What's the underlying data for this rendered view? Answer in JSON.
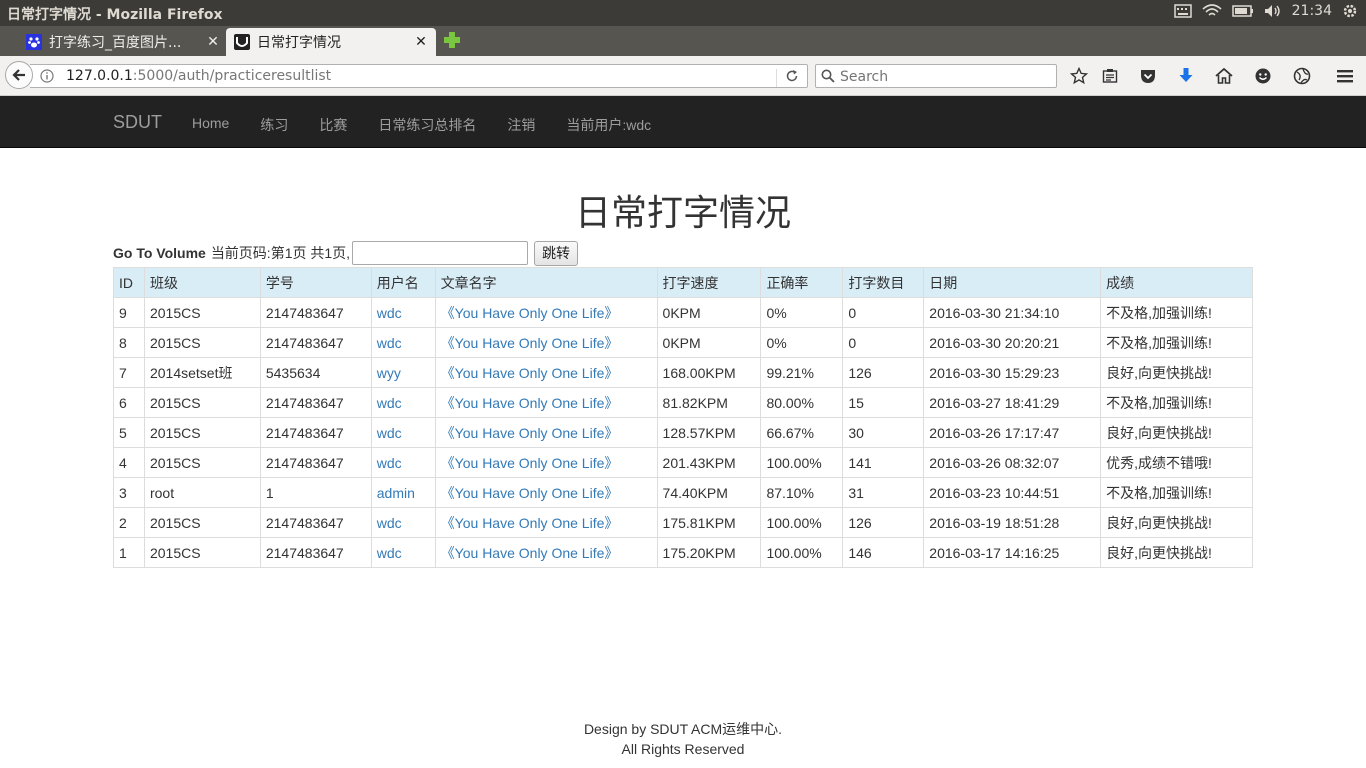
{
  "os": {
    "window_title": "日常打字情况 - Mozilla Firefox",
    "clock": "21:34"
  },
  "browser": {
    "tabs": [
      {
        "label": "打字练习_百度图片...",
        "active": false
      },
      {
        "label": "日常打字情况",
        "active": true
      }
    ],
    "url_host": "127.0.0.1",
    "url_path": ":5000/auth/practiceresultlist",
    "search_placeholder": "Search"
  },
  "site_nav": {
    "brand": "SDUT",
    "links": [
      "Home",
      "练习",
      "比赛",
      "日常练习总排名",
      "注销",
      "当前用户:wdc"
    ]
  },
  "page": {
    "title": "日常打字情况",
    "goto_label": "Go To Volume",
    "page_info": "当前页码:第1页 共1页,",
    "goto_input_value": "",
    "goto_button": "跳转"
  },
  "table": {
    "headers": [
      "ID",
      "班级",
      "学号",
      "用户名",
      "文章名字",
      "打字速度",
      "正确率",
      "打字数目",
      "日期",
      "成绩"
    ],
    "rows": [
      [
        "9",
        "2015CS",
        "2147483647",
        "wdc",
        "《You Have Only One Life》",
        "0KPM",
        "0%",
        "0",
        "2016-03-30 21:34:10",
        "不及格,加强训练!"
      ],
      [
        "8",
        "2015CS",
        "2147483647",
        "wdc",
        "《You Have Only One Life》",
        "0KPM",
        "0%",
        "0",
        "2016-03-30 20:20:21",
        "不及格,加强训练!"
      ],
      [
        "7",
        "2014setset班",
        "5435634",
        "wyy",
        "《You Have Only One Life》",
        "168.00KPM",
        "99.21%",
        "126",
        "2016-03-30 15:29:23",
        "良好,向更快挑战!"
      ],
      [
        "6",
        "2015CS",
        "2147483647",
        "wdc",
        "《You Have Only One Life》",
        "81.82KPM",
        "80.00%",
        "15",
        "2016-03-27 18:41:29",
        "不及格,加强训练!"
      ],
      [
        "5",
        "2015CS",
        "2147483647",
        "wdc",
        "《You Have Only One Life》",
        "128.57KPM",
        "66.67%",
        "30",
        "2016-03-26 17:17:47",
        "良好,向更快挑战!"
      ],
      [
        "4",
        "2015CS",
        "2147483647",
        "wdc",
        "《You Have Only One Life》",
        "201.43KPM",
        "100.00%",
        "141",
        "2016-03-26 08:32:07",
        "优秀,成绩不错哦!"
      ],
      [
        "3",
        "root",
        "1",
        "admin",
        "《You Have Only One Life》",
        "74.40KPM",
        "87.10%",
        "31",
        "2016-03-23 10:44:51",
        "不及格,加强训练!"
      ],
      [
        "2",
        "2015CS",
        "2147483647",
        "wdc",
        "《You Have Only One Life》",
        "175.81KPM",
        "100.00%",
        "126",
        "2016-03-19 18:51:28",
        "良好,向更快挑战!"
      ],
      [
        "1",
        "2015CS",
        "2147483647",
        "wdc",
        "《You Have Only One Life》",
        "175.20KPM",
        "100.00%",
        "146",
        "2016-03-17 14:16:25",
        "良好,向更快挑战!"
      ]
    ]
  },
  "footer": {
    "line1": "Design by SDUT ACM运维中心.",
    "line2": "All Rights Reserved"
  },
  "colors": {
    "link": "#337ab7",
    "header_bg": "#d9edf7",
    "navbar_bg": "#222222"
  }
}
